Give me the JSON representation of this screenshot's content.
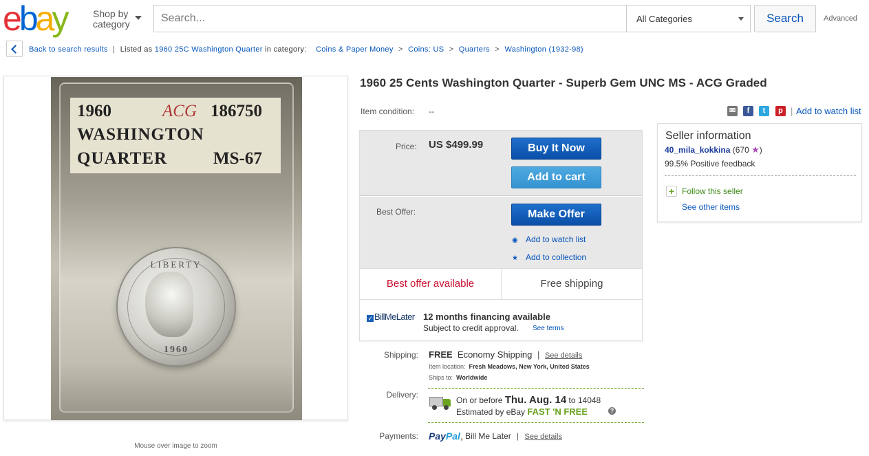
{
  "header": {
    "logo_letters": [
      "e",
      "b",
      "a",
      "y"
    ],
    "logo_colors": [
      "#e53238",
      "#0064d2",
      "#f5af02",
      "#86b817"
    ],
    "shop_by_line1": "Shop by",
    "shop_by_line2": "category",
    "search_placeholder": "Search...",
    "category_selected": "All Categories",
    "search_button": "Search",
    "advanced_link": "Advanced"
  },
  "breadcrumb": {
    "back_label": "Back to search results",
    "listed_prefix": "Listed as",
    "listed_title": "1960 25C Washington Quarter",
    "in_category": "in category:",
    "categories": [
      "Coins & Paper Money",
      "Coins: US",
      "Quarters",
      "Washington (1932-98)"
    ],
    "separator": ">"
  },
  "image": {
    "label_year": "1960",
    "label_brand": "ACG",
    "label_number": "186750",
    "label_line2": "WASHINGTON",
    "label_line3": "QUARTER",
    "label_grade": "MS-67",
    "coin_text": "LIBERTY",
    "coin_year": "1960",
    "zoom_hint": "Mouse over image to zoom"
  },
  "item": {
    "title": "1960 25 Cents Washington Quarter - Superb Gem UNC MS - ACG Graded",
    "condition_label": "Item condition:",
    "condition_value": "--"
  },
  "share": {
    "icons": [
      "mail-icon",
      "facebook-icon",
      "twitter-icon",
      "pinterest-icon"
    ],
    "separator": "|",
    "watch_label": "Add to watch list"
  },
  "buybox": {
    "price_label": "Price:",
    "price_value": "US $499.99",
    "buy_now": "Buy It Now",
    "add_to_cart": "Add to cart",
    "best_offer_label": "Best Offer:",
    "make_offer": "Make Offer",
    "add_watch": "Add to watch list",
    "add_collection": "Add to collection",
    "best_offer_available": "Best offer available",
    "free_shipping": "Free shipping",
    "bml_logo": "BillMeLater",
    "bml_title": "12 months financing available",
    "bml_sub": "Subject to credit approval.",
    "bml_terms": "See terms"
  },
  "shipping": {
    "label": "Shipping:",
    "free": "FREE",
    "method": "Economy Shipping",
    "separator": "|",
    "details": "See details",
    "location_label": "Item location:",
    "location_value": "Fresh Meadows, New York, United States",
    "ships_to_label": "Ships to:",
    "ships_to_value": "Worldwide"
  },
  "delivery": {
    "label": "Delivery:",
    "prefix": "On or before",
    "date": "Thu. Aug. 14",
    "to": "to 14048",
    "estimated": "Estimated by eBay",
    "fast": "FAST 'N FREE",
    "help": "?"
  },
  "payments": {
    "label": "Payments:",
    "paypal_1": "Pay",
    "paypal_2": "Pal",
    "bml": "Bill Me Later",
    "separator": "|",
    "details": "See details"
  },
  "seller": {
    "title": "Seller information",
    "name": "40_mila_kokkina",
    "score": "(670",
    "score_close": ")",
    "star": "★",
    "feedback": "99.5% Positive feedback",
    "follow": "Follow this seller",
    "follow_icon": "+",
    "other_items": "See other items"
  }
}
